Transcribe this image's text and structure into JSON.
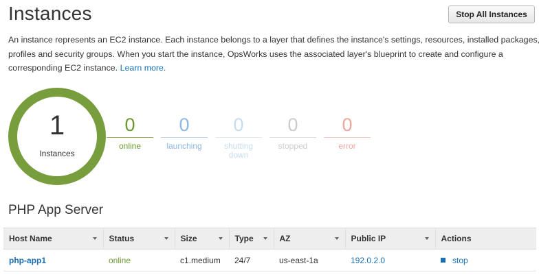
{
  "header": {
    "title": "Instances",
    "stop_all_label": "Stop All Instances"
  },
  "description": {
    "text": "An instance represents an EC2 instance. Each instance belongs to a layer that defines the instance's settings, resources, installed packages, profiles and security groups. When you start the instance, OpsWorks uses the associated layer's blueprint to create and configure a corresponding EC2 instance.",
    "learn_more": "Learn more."
  },
  "summary": {
    "total": "1",
    "total_label": "Instances",
    "ring_color": "#789d3d",
    "stats": [
      {
        "count": "0",
        "label": "online"
      },
      {
        "count": "0",
        "label": "launching"
      },
      {
        "count": "0",
        "label": "shutting down"
      },
      {
        "count": "0",
        "label": "stopped"
      },
      {
        "count": "0",
        "label": "error"
      }
    ]
  },
  "layer": {
    "name": "PHP App Server",
    "columns": [
      "Host Name",
      "Status",
      "Size",
      "Type",
      "AZ",
      "Public IP",
      "Actions"
    ],
    "rows": [
      {
        "host": "php-app1",
        "status": "online",
        "size": "c1.medium",
        "type": "24/7",
        "az": "us-east-1a",
        "ip": "192.0.2.0",
        "action": "stop"
      }
    ]
  },
  "colors": {
    "online": "#6a9a2f",
    "launching": "#8db8e3",
    "shutting_down": "#c7dcef",
    "stopped": "#cccccc",
    "error": "#eda79c",
    "link": "#1a6fb4"
  }
}
